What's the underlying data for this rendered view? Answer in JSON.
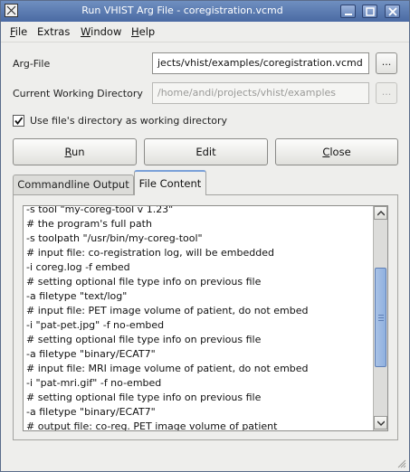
{
  "window": {
    "title": "Run VHIST Arg File - coregistration.vcmd"
  },
  "menu": [
    {
      "label": "File",
      "mn": "F",
      "rest": "ile"
    },
    {
      "label": "Extras",
      "mn": "",
      "rest": "Extras"
    },
    {
      "label": "Window",
      "mn": "W",
      "rest": "indow"
    },
    {
      "label": "Help",
      "mn": "H",
      "rest": "elp"
    }
  ],
  "argfile": {
    "label": "Arg-File",
    "value": "jects/vhist/examples/coregistration.vcmd",
    "browse_label": "..."
  },
  "cwd": {
    "label": "Current Working Directory",
    "value": "/home/andi/projects/vhist/examples",
    "browse_label": "..."
  },
  "use_file_dir": {
    "label": "Use file's directory as working directory",
    "checked": true
  },
  "buttons": {
    "run": {
      "mn": "R",
      "rest": "un"
    },
    "edit": {
      "label": "Edit"
    },
    "close": {
      "mn": "C",
      "rest": "lose"
    }
  },
  "tabs": [
    {
      "label": "Commandline Output",
      "active": false
    },
    {
      "label": "File Content",
      "active": true
    }
  ],
  "file_content": [
    "-s tool \"my-coreg-tool v 1.23\"",
    "# the program's full path",
    "-s toolpath \"/usr/bin/my-coreg-tool\"",
    "# input file: co-registration log, will be embedded",
    "-i coreg.log -f embed",
    "# setting optional file type info on previous file",
    "-a filetype \"text/log\"",
    "# input file: PET image volume of patient, do not embed",
    "-i \"pat-pet.jpg\" -f no-embed",
    "# setting optional file type info on previous file",
    "-a filetype \"binary/ECAT7\"",
    "# input file: MRI image volume of patient, do not embed",
    "-i \"pat-mri.gif\" -f no-embed",
    "# setting optional file type info on previous file",
    "-a filetype \"binary/ECAT7\"",
    "# output file: co-reg. PET image volume of patient"
  ],
  "scroll": {
    "position": 0.35,
    "visible_fraction": 0.45
  }
}
